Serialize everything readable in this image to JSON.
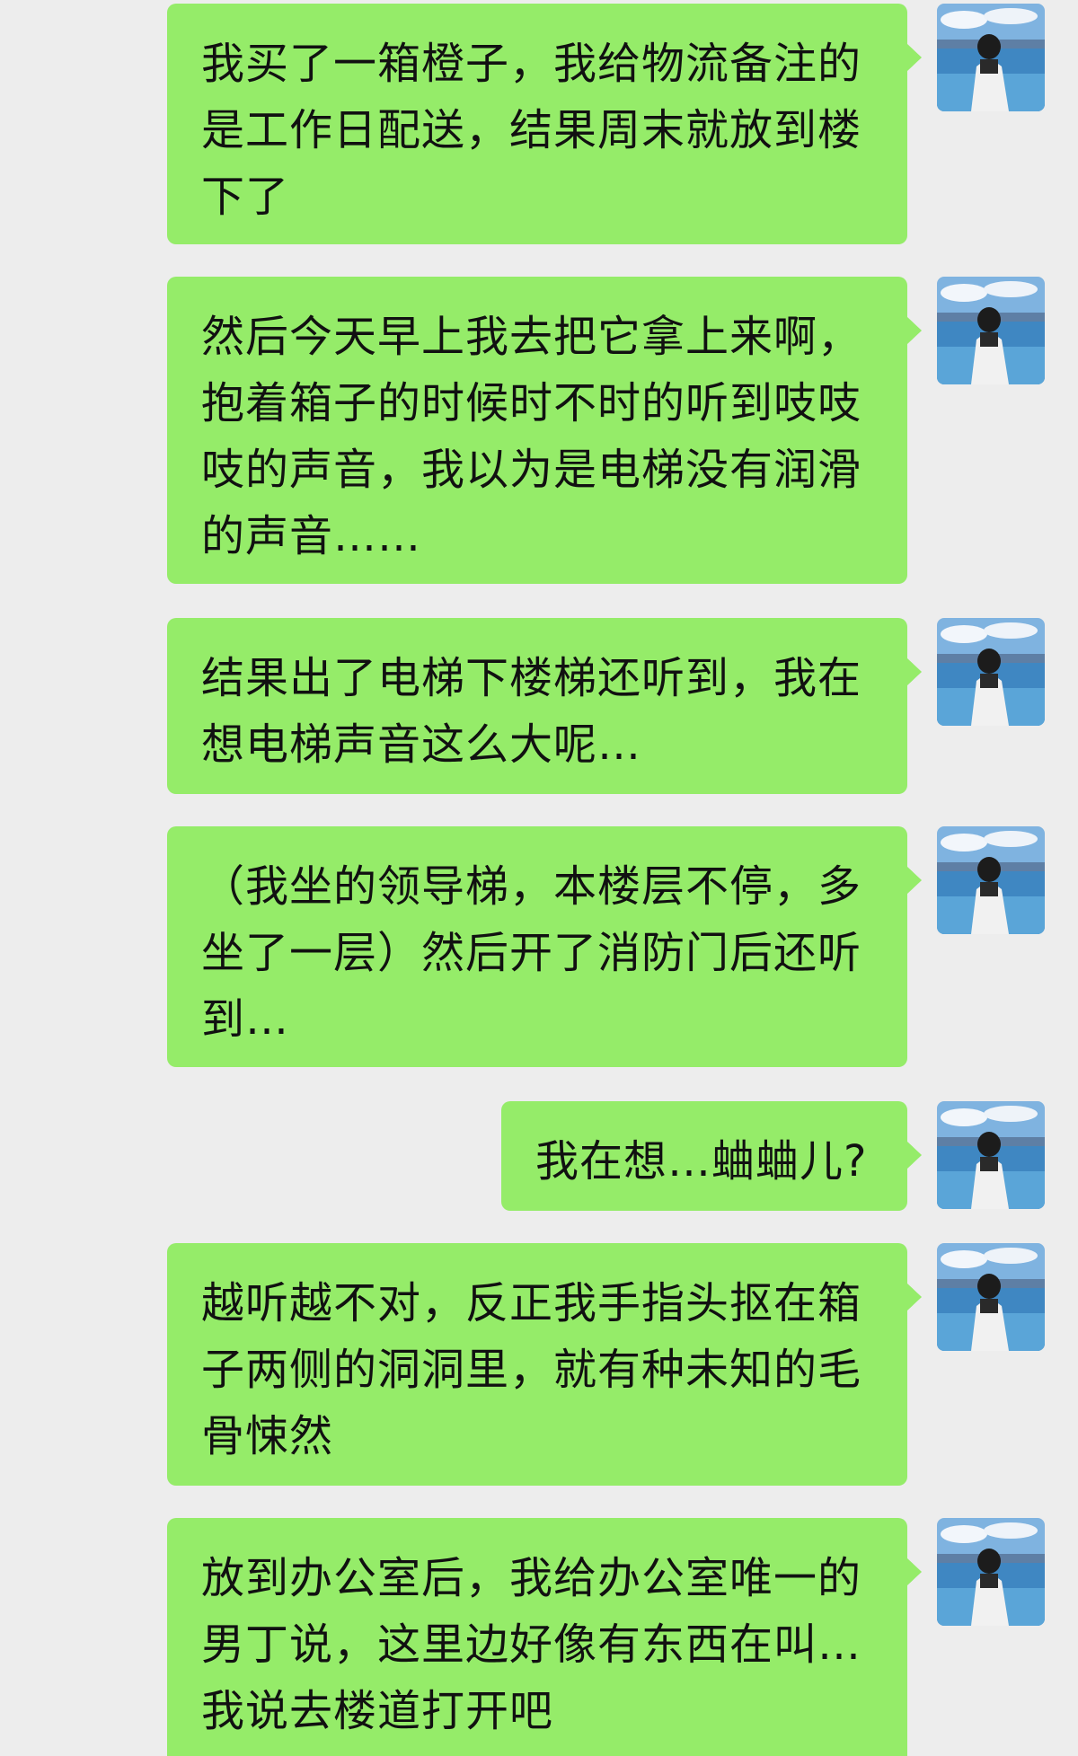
{
  "colors": {
    "background": "#ededed",
    "bubble": "#95ec69",
    "text": "#111111"
  },
  "avatar_icon": "profile-photo-lake-person",
  "messages": [
    {
      "sender": "me",
      "text": "我买了一箱橙子，我给物流备注的是工作日配送，结果周末就放到楼下了"
    },
    {
      "sender": "me",
      "text": "然后今天早上我去把它拿上来啊，抱着箱子的时候时不时的听到吱吱吱的声音，我以为是电梯没有润滑的声音……"
    },
    {
      "sender": "me",
      "text": "结果出了电梯下楼梯还听到，我在想电梯声音这么大呢…"
    },
    {
      "sender": "me",
      "text": "（我坐的领导梯，本楼层不停，多坐了一层）然后开了消防门后还听到…"
    },
    {
      "sender": "me",
      "text": "我在想…蛐蛐儿?"
    },
    {
      "sender": "me",
      "text": "越听越不对，反正我手指头抠在箱子两侧的洞洞里，就有种未知的毛骨悚然"
    },
    {
      "sender": "me",
      "text": "放到办公室后，我给办公室唯一的男丁说，这里边好像有东西在叫…我说去楼道打开吧"
    }
  ]
}
